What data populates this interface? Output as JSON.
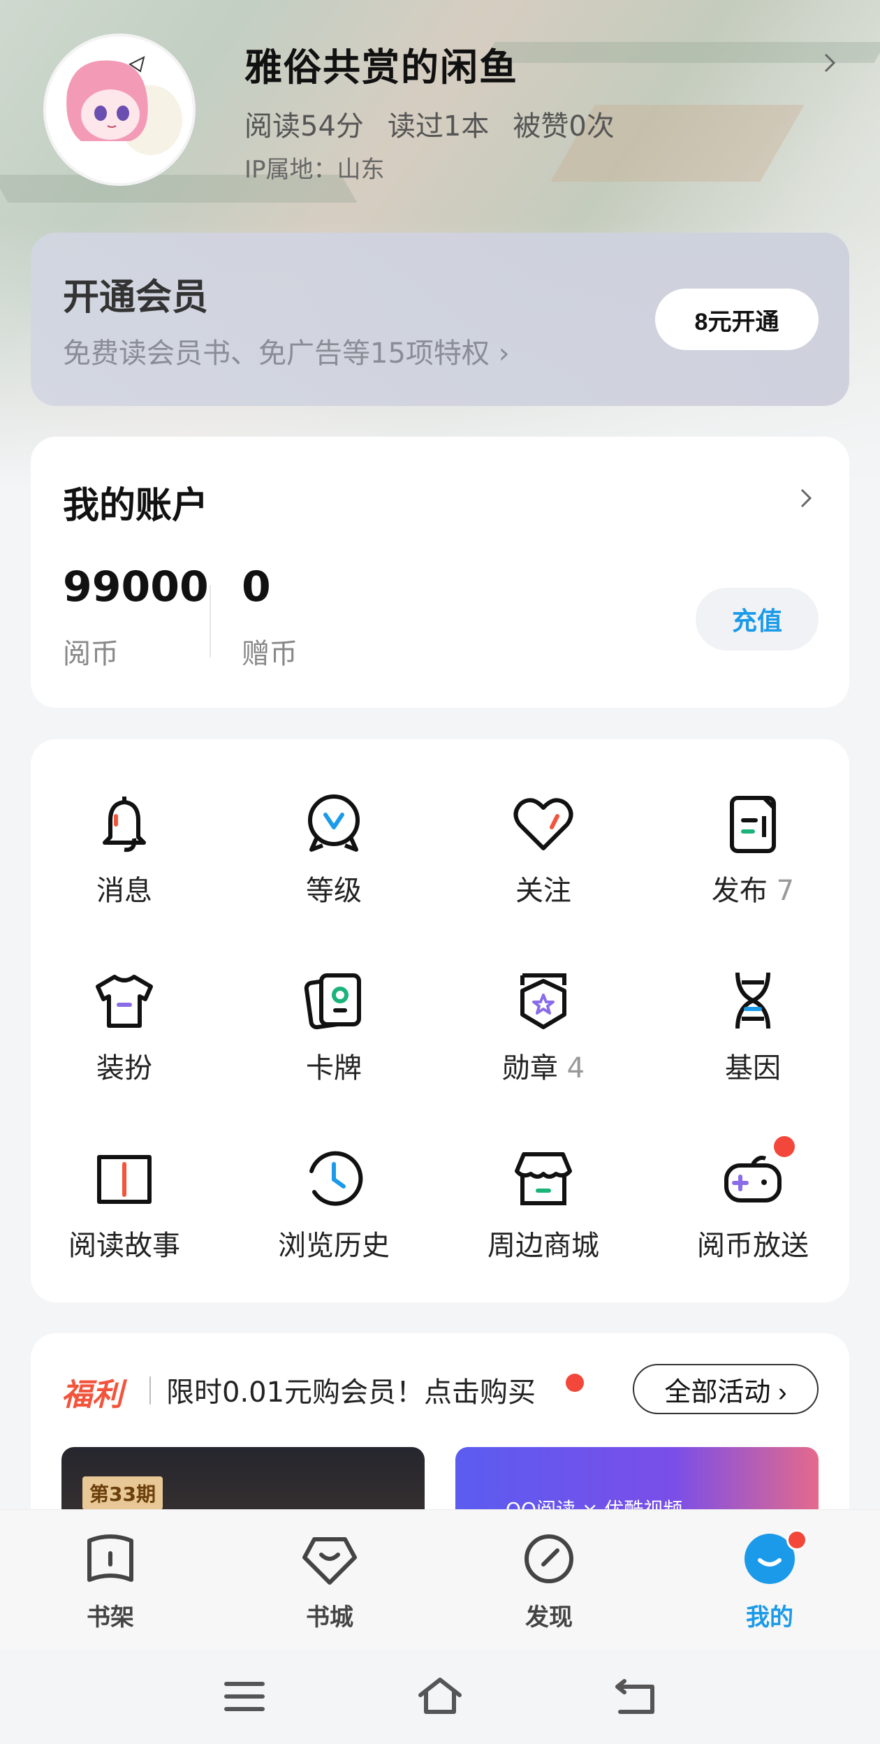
{
  "profile": {
    "username": "雅俗共赏的闲鱼",
    "stats": [
      "阅读54分",
      "读过1本",
      "被赞0次"
    ],
    "ip_location": "IP属地：山东"
  },
  "vip": {
    "title": "开通会员",
    "subtitle": "免费读会员书、免广告等15项特权 ›",
    "button": "8元开通"
  },
  "account": {
    "title": "我的账户",
    "coins": {
      "value": "99000",
      "label": "阅币"
    },
    "gift_coins": {
      "value": "0",
      "label": "赠币"
    },
    "recharge": "充值"
  },
  "grid": [
    {
      "label": "消息",
      "icon": "bell-icon"
    },
    {
      "label": "等级",
      "icon": "level-badge-icon"
    },
    {
      "label": "关注",
      "icon": "heart-icon"
    },
    {
      "label": "发布",
      "count": "7",
      "icon": "document-icon"
    },
    {
      "label": "装扮",
      "icon": "tshirt-icon"
    },
    {
      "label": "卡牌",
      "icon": "cards-icon"
    },
    {
      "label": "勋章",
      "count": "4",
      "icon": "medal-icon"
    },
    {
      "label": "基因",
      "icon": "dna-icon"
    },
    {
      "label": "阅读故事",
      "icon": "book-open-icon"
    },
    {
      "label": "浏览历史",
      "icon": "clock-history-icon"
    },
    {
      "label": "周边商城",
      "icon": "shop-icon"
    },
    {
      "label": "阅币放送",
      "icon": "gamepad-icon"
    }
  ],
  "welfare": {
    "tag": "福利",
    "text": "限时0.01元购会员！点击购买",
    "all_button": "全部活动 ›",
    "banner1_tag": "第33期",
    "banner2_text": "QQ阅读 × 优酷视频"
  },
  "tabs": [
    {
      "label": "书架",
      "icon": "bookshelf-icon"
    },
    {
      "label": "书城",
      "icon": "bookstore-icon"
    },
    {
      "label": "发现",
      "icon": "compass-icon"
    },
    {
      "label": "我的",
      "icon": "profile-face-icon",
      "active": true
    }
  ],
  "colors": {
    "accent": "#1a9ae8",
    "red": "#f2473a",
    "orange": "#f2543c"
  }
}
